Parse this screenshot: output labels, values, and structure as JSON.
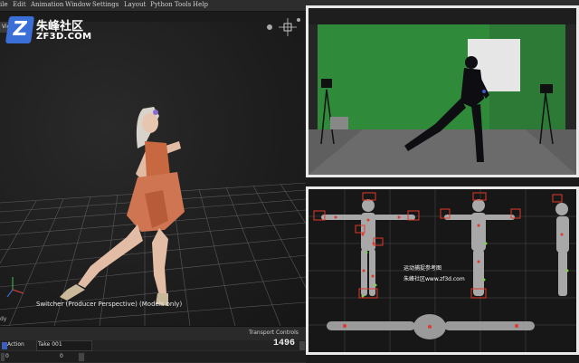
{
  "menu": {
    "items": [
      "ile",
      "Edit",
      "Animation",
      "Window",
      "Settings",
      "Layout",
      "Python Tools",
      "Help"
    ]
  },
  "viewport": {
    "tab_label": "View",
    "camera_label": "Switcher (Producer Perspective) (Models only)",
    "left_status": "dy"
  },
  "watermark": {
    "logo_letter": "Z",
    "chinese": "朱峰社区",
    "english": "ZF3D.COM"
  },
  "transport": {
    "title": "Transport Controls",
    "action_label": "Action",
    "take_label": "Take 001",
    "current_frame": "1496",
    "start_frame": "0",
    "end_frame": "0"
  },
  "mocap_reference": {
    "title": "运动捕捉参考图",
    "subtitle": "朱峰社区www.zf3d.com"
  },
  "colors": {
    "panel_border": "#e9e9e9",
    "green_screen": "#2f8a3a",
    "marker_red": "#e03a2a",
    "marker_green": "#7fd34a",
    "logo_blue": "#3a6fd8"
  }
}
